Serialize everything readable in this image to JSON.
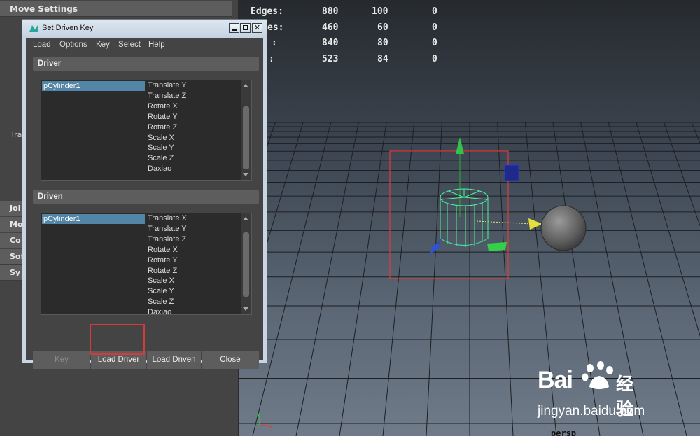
{
  "left_panel": {
    "header": "Move Settings",
    "partial_label": "Tra",
    "collapsed_rows": [
      "Joi",
      "Mo",
      "Co",
      "Sof",
      "Sy"
    ]
  },
  "viewport": {
    "hud_rows": [
      {
        "label": "Edges:",
        "v1": "880",
        "v2": "100",
        "v3": "0"
      },
      {
        "label": "es:",
        "v1": "460",
        "v2": "60",
        "v3": "0"
      },
      {
        "label": ":",
        "v1": "840",
        "v2": "80",
        "v3": "0"
      },
      {
        "label": ":",
        "v1": "523",
        "v2": "84",
        "v3": "0"
      }
    ],
    "camera_label": "persp",
    "axis_labels": {
      "y": "y",
      "x": "x"
    },
    "selection_color": "#e03b3b",
    "cylinder_color": "#4df29c"
  },
  "dialog": {
    "title": "Set Driven Key",
    "menu": [
      "Load",
      "Options",
      "Key",
      "Select",
      "Help"
    ],
    "driver": {
      "section_label": "Driver",
      "object": "pCylinder1",
      "attributes": [
        "Translate Y",
        "Translate Z",
        "Rotate X",
        "Rotate Y",
        "Rotate Z",
        "Scale X",
        "Scale Y",
        "Scale Z",
        "Daxiao"
      ]
    },
    "driven": {
      "section_label": "Driven",
      "object": "pCylinder1",
      "attributes": [
        "Translate X",
        "Translate Y",
        "Translate Z",
        "Rotate X",
        "Rotate Y",
        "Rotate Z",
        "Scale X",
        "Scale Y",
        "Scale Z",
        "Daxiao"
      ]
    },
    "buttons": {
      "key": "Key",
      "load_driver": "Load Driver",
      "load_driven": "Load Driven",
      "close": "Close"
    },
    "highlight_color": "#d13b3b"
  },
  "watermark": {
    "brand": "Bai",
    "brand_suffix": "经验",
    "url": "jingyan.baidu.com"
  }
}
